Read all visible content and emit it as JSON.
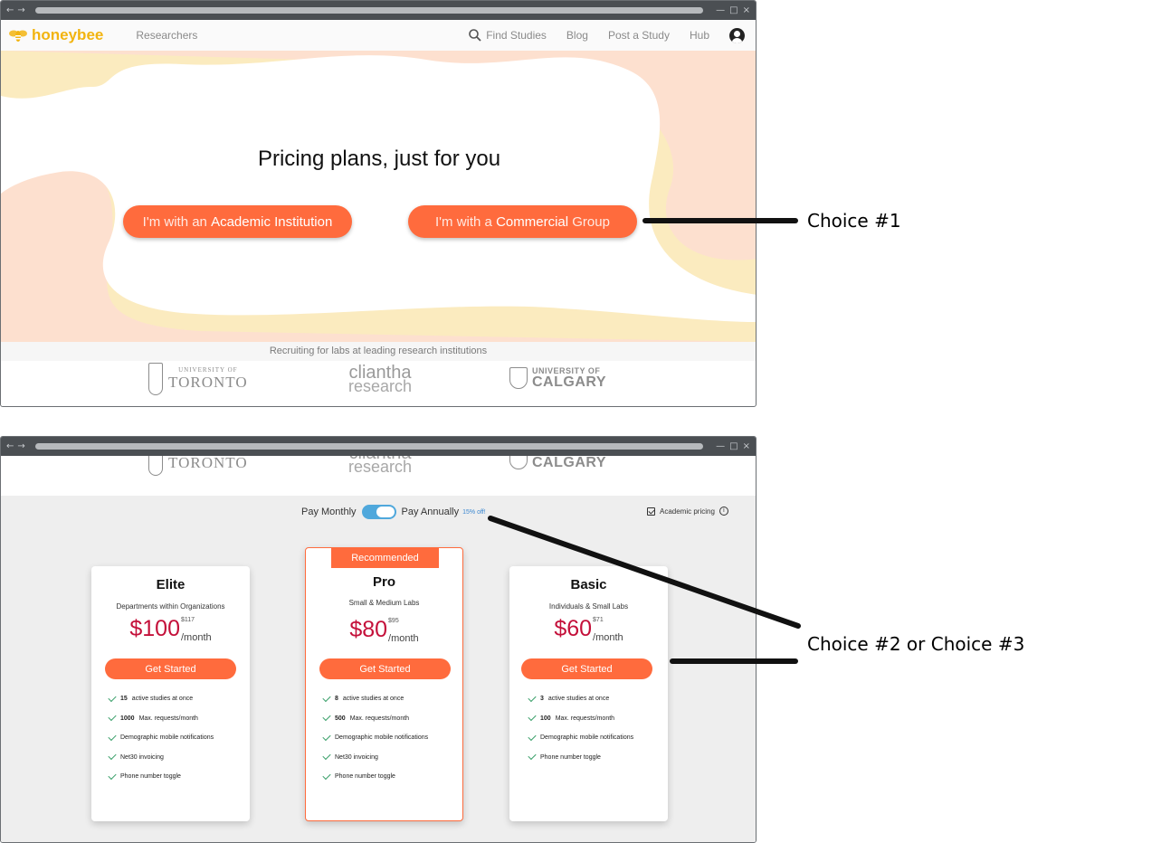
{
  "window1": {
    "brand": "honeybee",
    "nav_researchers": "Researchers",
    "nav_find": "Find Studies",
    "nav_blog": "Blog",
    "nav_post": "Post a Study",
    "nav_hub": "Hub",
    "hero_title": "Pricing plans, just for you",
    "cta_academic_pre": "I'm with an",
    "cta_academic_main": "Academic Institution",
    "cta_commercial_pre": "I'm with a",
    "cta_commercial_main": "Commercial",
    "cta_commercial_post": "Group",
    "institutions_caption": "Recruiting for labs at leading research institutions"
  },
  "institutions": {
    "uoft_top": "UNIVERSITY OF",
    "uoft_main": "TORONTO",
    "cliantha_top": "cliantha",
    "cliantha_bottom": "research",
    "ucal_top": "UNIVERSITY OF",
    "ucal_main": "CALGARY"
  },
  "window2": {
    "pay_monthly": "Pay Monthly",
    "pay_annually": "Pay Annually",
    "discount": "15% off!",
    "academic_pricing": "Academic pricing",
    "recommended": "Recommended",
    "plans": [
      {
        "name": "Elite",
        "subtitle": "Departments within Organizations",
        "price": "$100",
        "old_price": "$117",
        "per": "/month",
        "button": "Get Started",
        "features": [
          {
            "bold": "15",
            "text": "active studies at once"
          },
          {
            "bold": "1000",
            "text": "Max. requests/month"
          },
          {
            "bold": "",
            "text": "Demographic mobile notifications"
          },
          {
            "bold": "",
            "text": "Net30 invoicing"
          },
          {
            "bold": "",
            "text": "Phone number toggle"
          }
        ]
      },
      {
        "name": "Pro",
        "subtitle": "Small & Medium Labs",
        "price": "$80",
        "old_price": "$95",
        "per": "/month",
        "button": "Get Started",
        "features": [
          {
            "bold": "8",
            "text": "active studies at once"
          },
          {
            "bold": "500",
            "text": "Max. requests/month"
          },
          {
            "bold": "",
            "text": "Demographic mobile notifications"
          },
          {
            "bold": "",
            "text": "Net30 invoicing"
          },
          {
            "bold": "",
            "text": "Phone number toggle"
          }
        ]
      },
      {
        "name": "Basic",
        "subtitle": "Individuals & Small Labs",
        "price": "$60",
        "old_price": "$71",
        "per": "/month",
        "button": "Get Started",
        "features": [
          {
            "bold": "3",
            "text": "active studies at once"
          },
          {
            "bold": "100",
            "text": "Max. requests/month"
          },
          {
            "bold": "",
            "text": "Demographic mobile notifications"
          },
          {
            "bold": "",
            "text": "Phone number toggle"
          }
        ]
      }
    ]
  },
  "annotations": {
    "choice1": "Choice #1",
    "choice23": "Choice #2 or Choice #3"
  },
  "colors": {
    "accent": "#ff6b3d",
    "brand": "#f2b410",
    "price": "#c4103a",
    "toggle": "#4fa8dc",
    "hero_peach": "#fde0cf",
    "hero_yellow": "#fbebbf"
  }
}
